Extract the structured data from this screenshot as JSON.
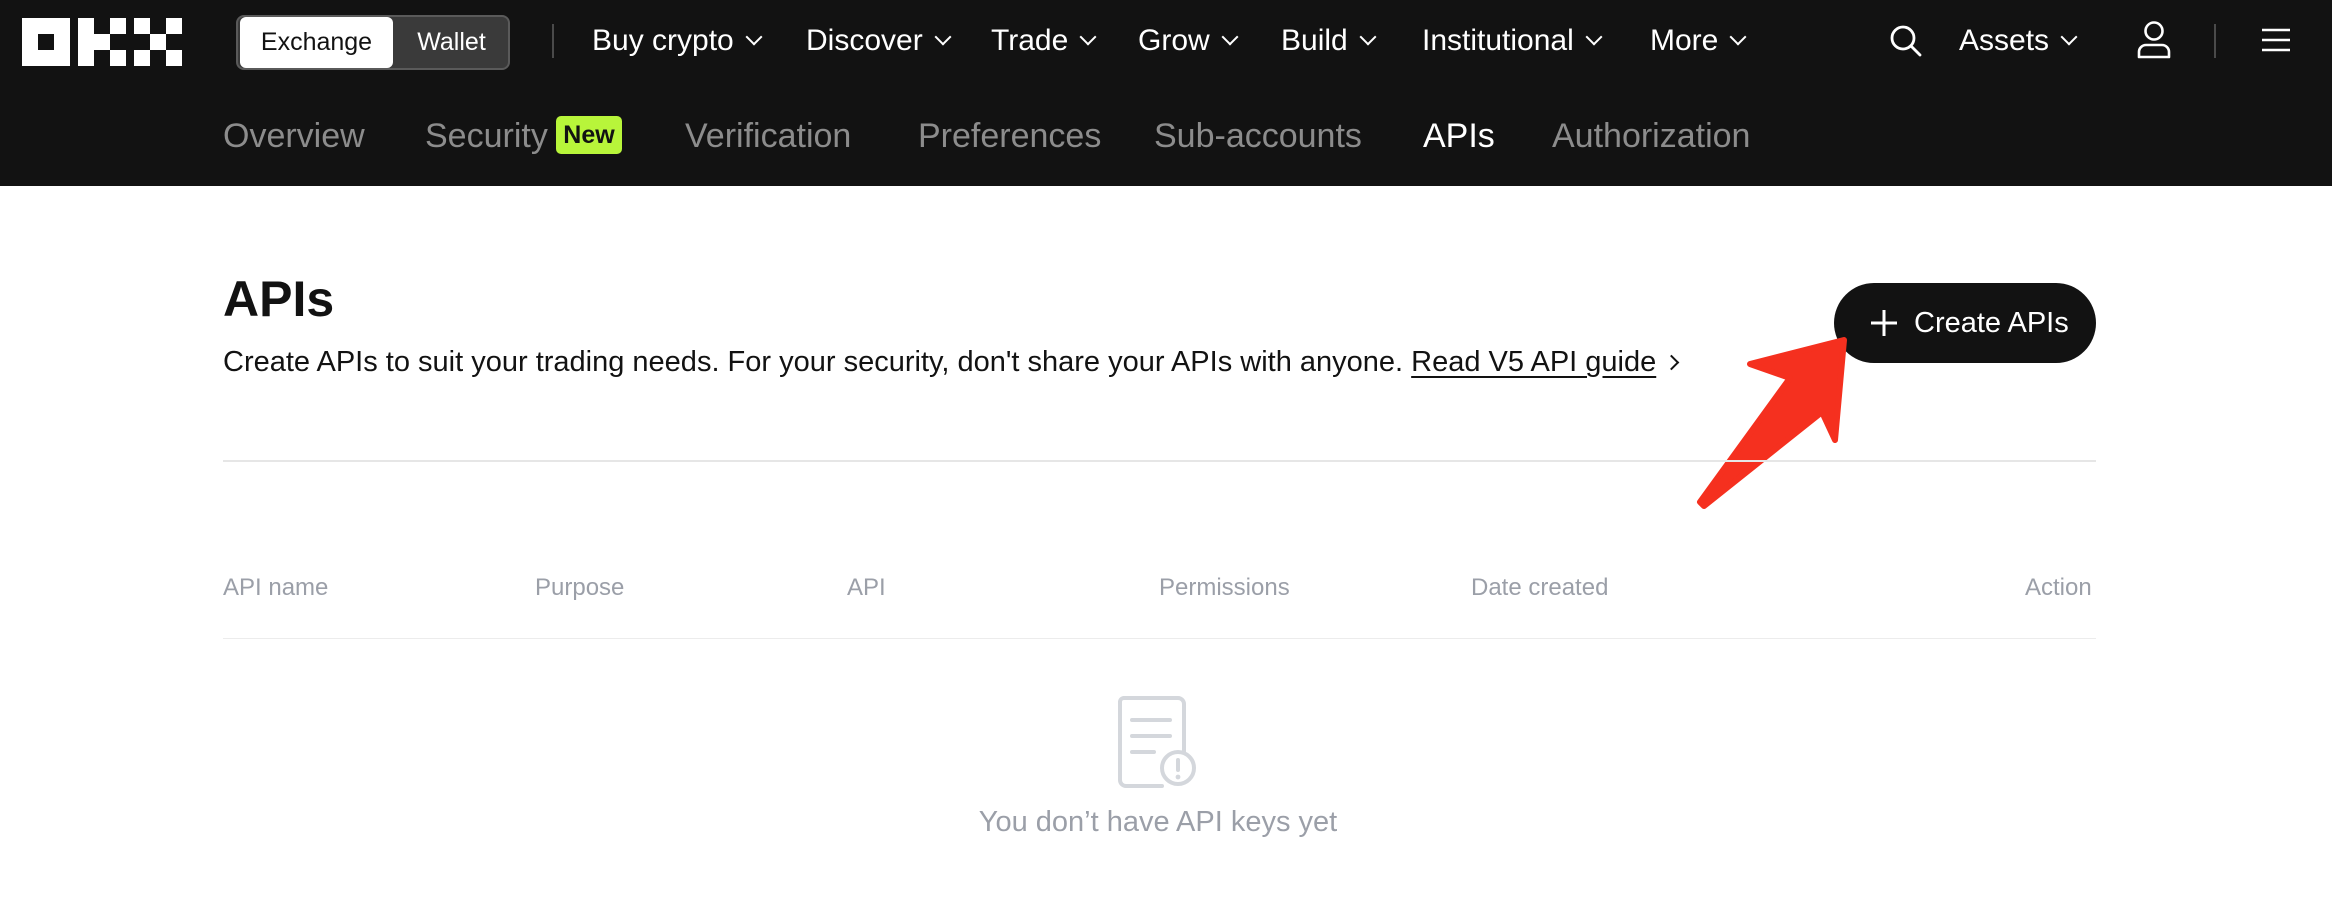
{
  "nav": {
    "segment": {
      "exchange": "Exchange",
      "wallet": "Wallet"
    },
    "items": [
      {
        "label": "Buy crypto"
      },
      {
        "label": "Discover"
      },
      {
        "label": "Trade"
      },
      {
        "label": "Grow"
      },
      {
        "label": "Build"
      },
      {
        "label": "Institutional"
      },
      {
        "label": "More"
      }
    ],
    "assets_label": "Assets",
    "icons": [
      "okx-logo",
      "search-icon",
      "chevron-down-icon",
      "user-icon",
      "menu-icon"
    ]
  },
  "subnav": {
    "tabs": [
      {
        "label": "Overview"
      },
      {
        "label": "Security",
        "badge": "New"
      },
      {
        "label": "Verification"
      },
      {
        "label": "Preferences"
      },
      {
        "label": "Sub-accounts"
      },
      {
        "label": "APIs",
        "active": true
      },
      {
        "label": "Authorization"
      }
    ]
  },
  "main": {
    "title": "APIs",
    "description": "Create APIs to suit your trading needs. For your security, don't share your APIs with anyone.",
    "guide_link": "Read V5 API guide",
    "create_button": "Create APIs",
    "table": {
      "headers": [
        "API name",
        "Purpose",
        "API",
        "Permissions",
        "Date created",
        "Action"
      ]
    },
    "empty_text": "You don’t have API keys yet"
  },
  "colors": {
    "topbar_bg": "#121212",
    "new_badge": "#b8f53a",
    "annotation_arrow": "#f5301f",
    "muted_text": "#9b9fa8"
  }
}
